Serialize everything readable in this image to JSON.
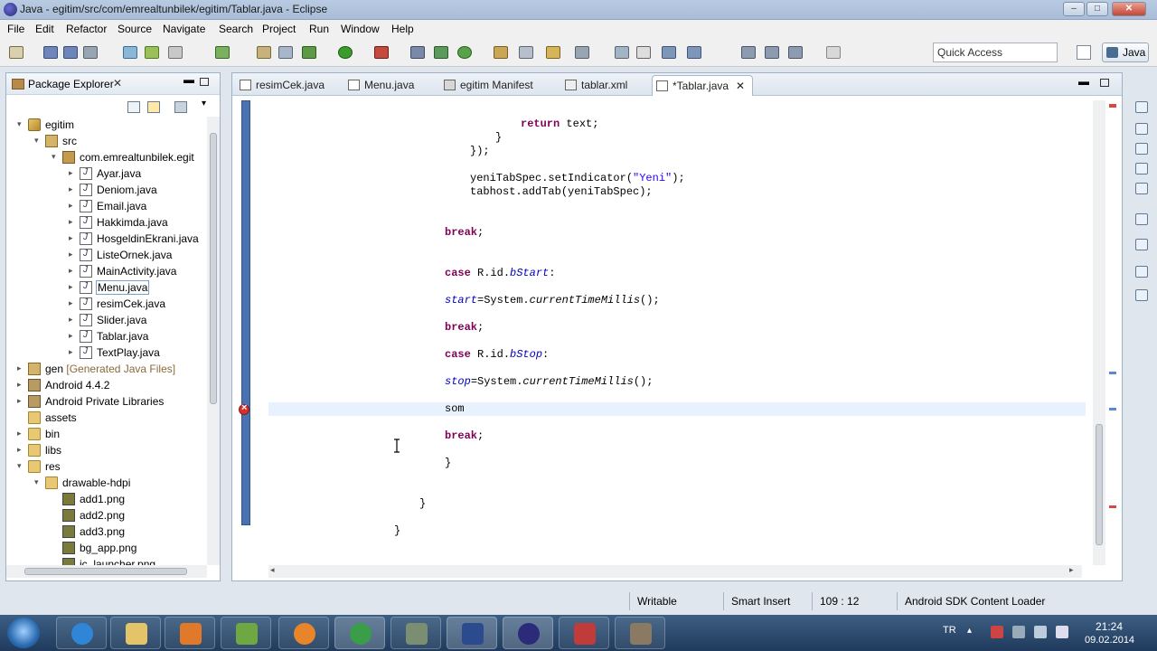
{
  "window": {
    "title": "Java - egitim/src/com/emrealtunbilek/egitim/Tablar.java - Eclipse",
    "minimize": "‒",
    "maximize": "□",
    "close": "✕"
  },
  "menu": [
    "File",
    "Edit",
    "Refactor",
    "Source",
    "Navigate",
    "Search",
    "Project",
    "Run",
    "Window",
    "Help"
  ],
  "toolbar": {
    "quick_access": "Quick Access",
    "perspective": "Java"
  },
  "package_explorer": {
    "title": "Package Explorer",
    "close": "✕",
    "min": "▬",
    "tree": [
      {
        "label": "egitim",
        "level": 0,
        "toggle": "▾",
        "icon": "project"
      },
      {
        "label": "src",
        "level": 1,
        "toggle": "▾",
        "icon": "srcf"
      },
      {
        "label": "com.emrealtunbilek.egit",
        "level": 2,
        "toggle": "▾",
        "icon": "pkgi"
      },
      {
        "label": "Ayar.java",
        "level": 3,
        "toggle": "▸",
        "icon": "java"
      },
      {
        "label": "Deniom.java",
        "level": 3,
        "toggle": "▸",
        "icon": "java"
      },
      {
        "label": "Email.java",
        "level": 3,
        "toggle": "▸",
        "icon": "java"
      },
      {
        "label": "Hakkimda.java",
        "level": 3,
        "toggle": "▸",
        "icon": "java"
      },
      {
        "label": "HosgeldinEkrani.java",
        "level": 3,
        "toggle": "▸",
        "icon": "java"
      },
      {
        "label": "ListeOrnek.java",
        "level": 3,
        "toggle": "▸",
        "icon": "java"
      },
      {
        "label": "MainActivity.java",
        "level": 3,
        "toggle": "▸",
        "icon": "java"
      },
      {
        "label": "Menu.java",
        "level": 3,
        "toggle": "▸",
        "icon": "java",
        "selected": true
      },
      {
        "label": "resimCek.java",
        "level": 3,
        "toggle": "▸",
        "icon": "java"
      },
      {
        "label": "Slider.java",
        "level": 3,
        "toggle": "▸",
        "icon": "java"
      },
      {
        "label": "Tablar.java",
        "level": 3,
        "toggle": "▸",
        "icon": "java"
      },
      {
        "label": "TextPlay.java",
        "level": 3,
        "toggle": "▸",
        "icon": "java"
      },
      {
        "label": "gen",
        "decoration": "[Generated Java Files]",
        "level": 0,
        "toggle": "▸",
        "icon": "srcf"
      },
      {
        "label": "Android 4.4.2",
        "level": 0,
        "toggle": "▸",
        "icon": "lib"
      },
      {
        "label": "Android Private Libraries",
        "level": 0,
        "toggle": "▸",
        "icon": "lib"
      },
      {
        "label": "assets",
        "level": 0,
        "toggle": "",
        "icon": "folder"
      },
      {
        "label": "bin",
        "level": 0,
        "toggle": "▸",
        "icon": "folder"
      },
      {
        "label": "libs",
        "level": 0,
        "toggle": "▸",
        "icon": "folder"
      },
      {
        "label": "res",
        "level": 0,
        "toggle": "▾",
        "icon": "folder"
      },
      {
        "label": "drawable-hdpi",
        "level": 1,
        "toggle": "▾",
        "icon": "folder"
      },
      {
        "label": "add1.png",
        "level": 2,
        "toggle": "",
        "icon": "img"
      },
      {
        "label": "add2.png",
        "level": 2,
        "toggle": "",
        "icon": "img"
      },
      {
        "label": "add3.png",
        "level": 2,
        "toggle": "",
        "icon": "img"
      },
      {
        "label": "bg_app.png",
        "level": 2,
        "toggle": "",
        "icon": "img"
      },
      {
        "label": "ic_launcher.png",
        "level": 2,
        "toggle": "",
        "icon": "img"
      }
    ]
  },
  "editor": {
    "tabs": [
      {
        "label": "resimCek.java"
      },
      {
        "label": "Menu.java"
      },
      {
        "label": "egitim Manifest"
      },
      {
        "label": "tablar.xml"
      },
      {
        "label": "*Tablar.java",
        "active": true,
        "close": "✕"
      }
    ],
    "min": "▬",
    "code": [
      {
        "indent": 40,
        "tokens": [
          [
            "kw",
            "return"
          ],
          [
            "",
            " text;"
          ]
        ]
      },
      {
        "indent": 36,
        "tokens": [
          [
            "",
            "}"
          ]
        ]
      },
      {
        "indent": 32,
        "tokens": [
          [
            "",
            "});"
          ]
        ]
      },
      {
        "indent": 0,
        "tokens": []
      },
      {
        "indent": 32,
        "tokens": [
          [
            "",
            "yeniTabSpec.setIndicator("
          ],
          [
            "str",
            "\"Yeni\""
          ],
          [
            "",
            ");"
          ]
        ]
      },
      {
        "indent": 32,
        "tokens": [
          [
            "",
            "tabhost.addTab(yeniTabSpec);"
          ]
        ]
      },
      {
        "indent": 0,
        "tokens": []
      },
      {
        "indent": 0,
        "tokens": []
      },
      {
        "indent": 28,
        "tokens": [
          [
            "kw",
            "break"
          ],
          [
            "",
            ";"
          ]
        ]
      },
      {
        "indent": 0,
        "tokens": []
      },
      {
        "indent": 0,
        "tokens": []
      },
      {
        "indent": 28,
        "tokens": [
          [
            "kw",
            "case"
          ],
          [
            "",
            " R.id."
          ],
          [
            "fld",
            "bStart"
          ],
          [
            "",
            ":"
          ]
        ]
      },
      {
        "indent": 0,
        "tokens": []
      },
      {
        "indent": 28,
        "tokens": [
          [
            "fld",
            "start"
          ],
          [
            "",
            "=System."
          ],
          [
            "sm",
            "currentTimeMillis"
          ],
          [
            "",
            "();"
          ]
        ]
      },
      {
        "indent": 0,
        "tokens": []
      },
      {
        "indent": 28,
        "tokens": [
          [
            "kw",
            "break"
          ],
          [
            "",
            ";"
          ]
        ]
      },
      {
        "indent": 0,
        "tokens": []
      },
      {
        "indent": 28,
        "tokens": [
          [
            "kw",
            "case"
          ],
          [
            "",
            " R.id."
          ],
          [
            "fld",
            "bStop"
          ],
          [
            "",
            ":"
          ]
        ]
      },
      {
        "indent": 0,
        "tokens": []
      },
      {
        "indent": 28,
        "tokens": [
          [
            "fld",
            "stop"
          ],
          [
            "",
            "=System."
          ],
          [
            "sm",
            "currentTimeMillis"
          ],
          [
            "",
            "();"
          ]
        ]
      },
      {
        "indent": 0,
        "tokens": []
      },
      {
        "indent": 28,
        "tokens": [
          [
            "",
            "som"
          ]
        ]
      },
      {
        "indent": 0,
        "tokens": []
      },
      {
        "indent": 28,
        "tokens": [
          [
            "kw",
            "break"
          ],
          [
            "",
            ";"
          ]
        ]
      },
      {
        "indent": 0,
        "tokens": []
      },
      {
        "indent": 28,
        "tokens": [
          [
            "",
            "}"
          ]
        ]
      },
      {
        "indent": 0,
        "tokens": []
      },
      {
        "indent": 0,
        "tokens": []
      },
      {
        "indent": 24,
        "tokens": [
          [
            "",
            "}"
          ]
        ]
      },
      {
        "indent": 0,
        "tokens": []
      },
      {
        "indent": 20,
        "tokens": [
          [
            "",
            "}"
          ]
        ]
      }
    ]
  },
  "statusbar": {
    "mode": "Writable",
    "insert": "Smart Insert",
    "position": "109 : 12",
    "task": "Android SDK Content Loader"
  },
  "taskbar": {
    "tray_lang": "TR",
    "time": "21:24",
    "date": "09.02.2014",
    "apps": [
      "internet-explorer",
      "file-explorer",
      "media-player",
      "notepad",
      "firefox",
      "chrome",
      "android-sdk",
      "eclipse-alt",
      "eclipse",
      "link-app",
      "tools-app"
    ]
  },
  "colors": {
    "keyword": "#7f0055",
    "string": "#2a00ff",
    "field": "#0000c0",
    "error": "#d4302c"
  }
}
